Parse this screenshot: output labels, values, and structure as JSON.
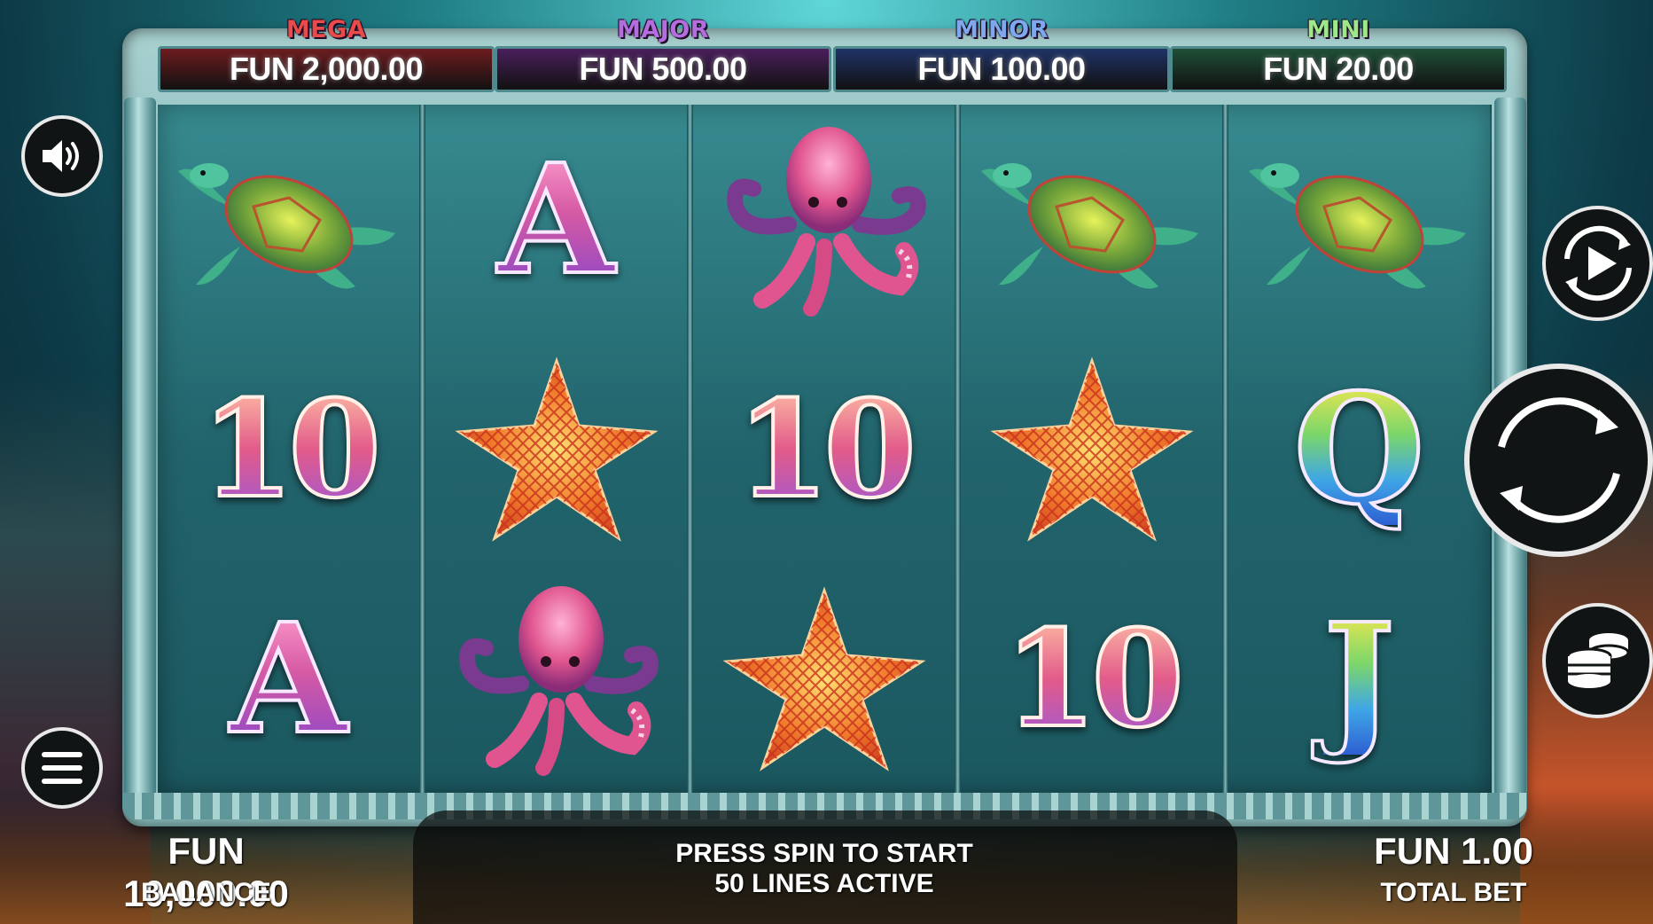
{
  "jackpots": [
    {
      "name": "MEGA",
      "value": "FUN 2,000.00",
      "color": "#e94b4b",
      "box_color": "#6d1c1f"
    },
    {
      "name": "MAJOR",
      "value": "FUN 500.00",
      "color": "#b36ddf",
      "box_color": "#4a1f5c"
    },
    {
      "name": "MINOR",
      "value": "FUN 100.00",
      "color": "#7fa7ee",
      "box_color": "#1f3366"
    },
    {
      "name": "MINI",
      "value": "FUN 20.00",
      "color": "#9ee88a",
      "box_color": "#1f4f37"
    }
  ],
  "reels": [
    [
      "turtle",
      "10",
      "A"
    ],
    [
      "A",
      "starfish",
      "octopus"
    ],
    [
      "octopus",
      "10",
      "starfish"
    ],
    [
      "turtle",
      "starfish",
      "10"
    ],
    [
      "turtle",
      "Q",
      "J"
    ]
  ],
  "status": {
    "line1": "PRESS SPIN TO START",
    "line2": "50 LINES ACTIVE"
  },
  "balance": {
    "value": "FUN 10,000.00",
    "label": "BALANCE"
  },
  "total_bet": {
    "value": "FUN 1.00",
    "label": "TOTAL BET"
  },
  "buttons": {
    "sound": "speaker-icon",
    "menu": "hamburger-menu-icon",
    "autoplay": "autoplay-icon",
    "spin": "spin-arrows-icon",
    "bet": "coin-stack-icon"
  }
}
